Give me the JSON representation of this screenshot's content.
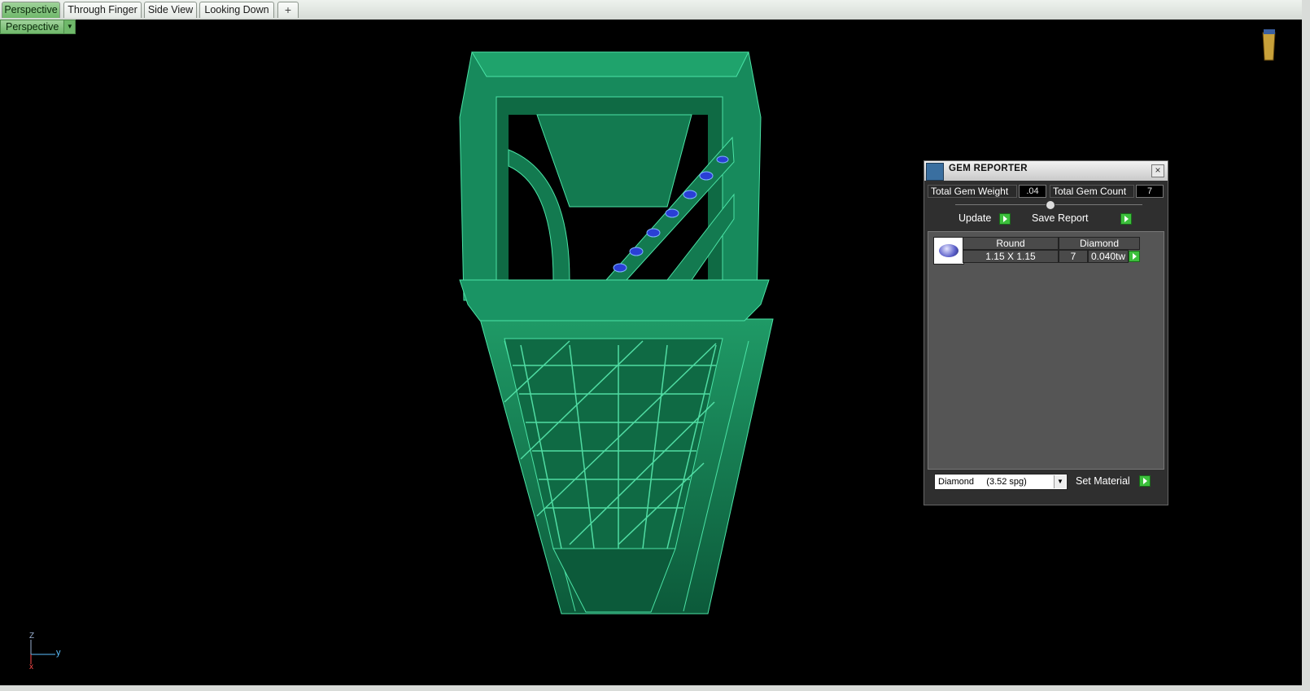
{
  "tabs": [
    {
      "label": "Perspective",
      "active": true
    },
    {
      "label": "Through Finger",
      "active": false
    },
    {
      "label": "Side View",
      "active": false
    },
    {
      "label": "Looking Down",
      "active": false
    }
  ],
  "add_tab_icon": "plus-icon",
  "view_dropdown": {
    "label": "Perspective"
  },
  "gem_reporter": {
    "title": "GEM REPORTER",
    "total_gem_weight_label": "Total Gem Weight",
    "total_gem_weight_value": ".04",
    "total_gem_count_label": "Total Gem Count",
    "total_gem_count_value": "7",
    "update_label": "Update",
    "save_report_label": "Save Report",
    "row": {
      "shape": "Round",
      "material": "Diamond",
      "size": "1.15 X 1.15",
      "count": "7",
      "weight": "0.040tw"
    },
    "material_select": "Diamond     (3.52 spg)",
    "set_material_label": "Set Material"
  },
  "axes": {
    "z": "Z",
    "y": "y",
    "x": "x"
  },
  "colors": {
    "model": "#1a8a5a",
    "accent": "#6fb86a",
    "gem_blue": "#2a3fd6"
  }
}
